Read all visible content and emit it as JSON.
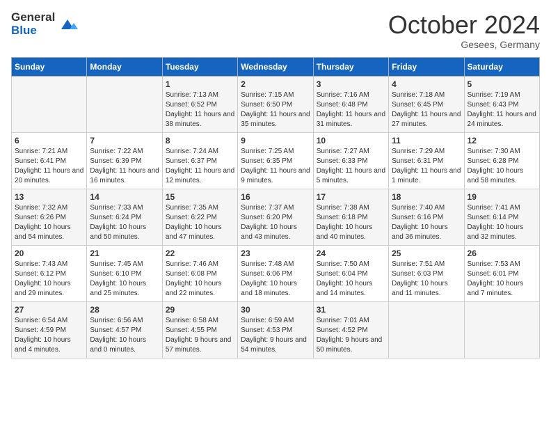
{
  "header": {
    "logo_line1": "General",
    "logo_line2": "Blue",
    "month_title": "October 2024",
    "location": "Gesees, Germany"
  },
  "weekdays": [
    "Sunday",
    "Monday",
    "Tuesday",
    "Wednesday",
    "Thursday",
    "Friday",
    "Saturday"
  ],
  "weeks": [
    [
      {
        "day": "",
        "content": ""
      },
      {
        "day": "",
        "content": ""
      },
      {
        "day": "1",
        "content": "Sunrise: 7:13 AM\nSunset: 6:52 PM\nDaylight: 11 hours and 38 minutes."
      },
      {
        "day": "2",
        "content": "Sunrise: 7:15 AM\nSunset: 6:50 PM\nDaylight: 11 hours and 35 minutes."
      },
      {
        "day": "3",
        "content": "Sunrise: 7:16 AM\nSunset: 6:48 PM\nDaylight: 11 hours and 31 minutes."
      },
      {
        "day": "4",
        "content": "Sunrise: 7:18 AM\nSunset: 6:45 PM\nDaylight: 11 hours and 27 minutes."
      },
      {
        "day": "5",
        "content": "Sunrise: 7:19 AM\nSunset: 6:43 PM\nDaylight: 11 hours and 24 minutes."
      }
    ],
    [
      {
        "day": "6",
        "content": "Sunrise: 7:21 AM\nSunset: 6:41 PM\nDaylight: 11 hours and 20 minutes."
      },
      {
        "day": "7",
        "content": "Sunrise: 7:22 AM\nSunset: 6:39 PM\nDaylight: 11 hours and 16 minutes."
      },
      {
        "day": "8",
        "content": "Sunrise: 7:24 AM\nSunset: 6:37 PM\nDaylight: 11 hours and 12 minutes."
      },
      {
        "day": "9",
        "content": "Sunrise: 7:25 AM\nSunset: 6:35 PM\nDaylight: 11 hours and 9 minutes."
      },
      {
        "day": "10",
        "content": "Sunrise: 7:27 AM\nSunset: 6:33 PM\nDaylight: 11 hours and 5 minutes."
      },
      {
        "day": "11",
        "content": "Sunrise: 7:29 AM\nSunset: 6:31 PM\nDaylight: 11 hours and 1 minute."
      },
      {
        "day": "12",
        "content": "Sunrise: 7:30 AM\nSunset: 6:28 PM\nDaylight: 10 hours and 58 minutes."
      }
    ],
    [
      {
        "day": "13",
        "content": "Sunrise: 7:32 AM\nSunset: 6:26 PM\nDaylight: 10 hours and 54 minutes."
      },
      {
        "day": "14",
        "content": "Sunrise: 7:33 AM\nSunset: 6:24 PM\nDaylight: 10 hours and 50 minutes."
      },
      {
        "day": "15",
        "content": "Sunrise: 7:35 AM\nSunset: 6:22 PM\nDaylight: 10 hours and 47 minutes."
      },
      {
        "day": "16",
        "content": "Sunrise: 7:37 AM\nSunset: 6:20 PM\nDaylight: 10 hours and 43 minutes."
      },
      {
        "day": "17",
        "content": "Sunrise: 7:38 AM\nSunset: 6:18 PM\nDaylight: 10 hours and 40 minutes."
      },
      {
        "day": "18",
        "content": "Sunrise: 7:40 AM\nSunset: 6:16 PM\nDaylight: 10 hours and 36 minutes."
      },
      {
        "day": "19",
        "content": "Sunrise: 7:41 AM\nSunset: 6:14 PM\nDaylight: 10 hours and 32 minutes."
      }
    ],
    [
      {
        "day": "20",
        "content": "Sunrise: 7:43 AM\nSunset: 6:12 PM\nDaylight: 10 hours and 29 minutes."
      },
      {
        "day": "21",
        "content": "Sunrise: 7:45 AM\nSunset: 6:10 PM\nDaylight: 10 hours and 25 minutes."
      },
      {
        "day": "22",
        "content": "Sunrise: 7:46 AM\nSunset: 6:08 PM\nDaylight: 10 hours and 22 minutes."
      },
      {
        "day": "23",
        "content": "Sunrise: 7:48 AM\nSunset: 6:06 PM\nDaylight: 10 hours and 18 minutes."
      },
      {
        "day": "24",
        "content": "Sunrise: 7:50 AM\nSunset: 6:04 PM\nDaylight: 10 hours and 14 minutes."
      },
      {
        "day": "25",
        "content": "Sunrise: 7:51 AM\nSunset: 6:03 PM\nDaylight: 10 hours and 11 minutes."
      },
      {
        "day": "26",
        "content": "Sunrise: 7:53 AM\nSunset: 6:01 PM\nDaylight: 10 hours and 7 minutes."
      }
    ],
    [
      {
        "day": "27",
        "content": "Sunrise: 6:54 AM\nSunset: 4:59 PM\nDaylight: 10 hours and 4 minutes."
      },
      {
        "day": "28",
        "content": "Sunrise: 6:56 AM\nSunset: 4:57 PM\nDaylight: 10 hours and 0 minutes."
      },
      {
        "day": "29",
        "content": "Sunrise: 6:58 AM\nSunset: 4:55 PM\nDaylight: 9 hours and 57 minutes."
      },
      {
        "day": "30",
        "content": "Sunrise: 6:59 AM\nSunset: 4:53 PM\nDaylight: 9 hours and 54 minutes."
      },
      {
        "day": "31",
        "content": "Sunrise: 7:01 AM\nSunset: 4:52 PM\nDaylight: 9 hours and 50 minutes."
      },
      {
        "day": "",
        "content": ""
      },
      {
        "day": "",
        "content": ""
      }
    ]
  ]
}
